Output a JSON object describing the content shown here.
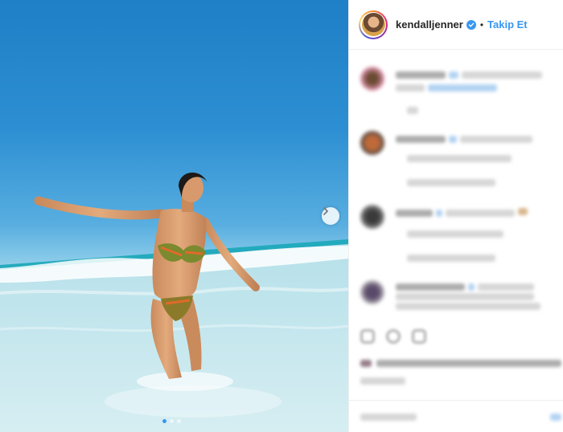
{
  "post": {
    "username": "kendalljenner",
    "separator": "•",
    "follow_label": "Takip Et",
    "carousel": {
      "total_slides": 3,
      "active_slide": 1
    }
  },
  "icons": {
    "verified": "verified-badge-icon",
    "next": "chevron-right-icon"
  },
  "colors": {
    "accent": "#3897f0",
    "text": "#262626",
    "border": "#efefef"
  }
}
